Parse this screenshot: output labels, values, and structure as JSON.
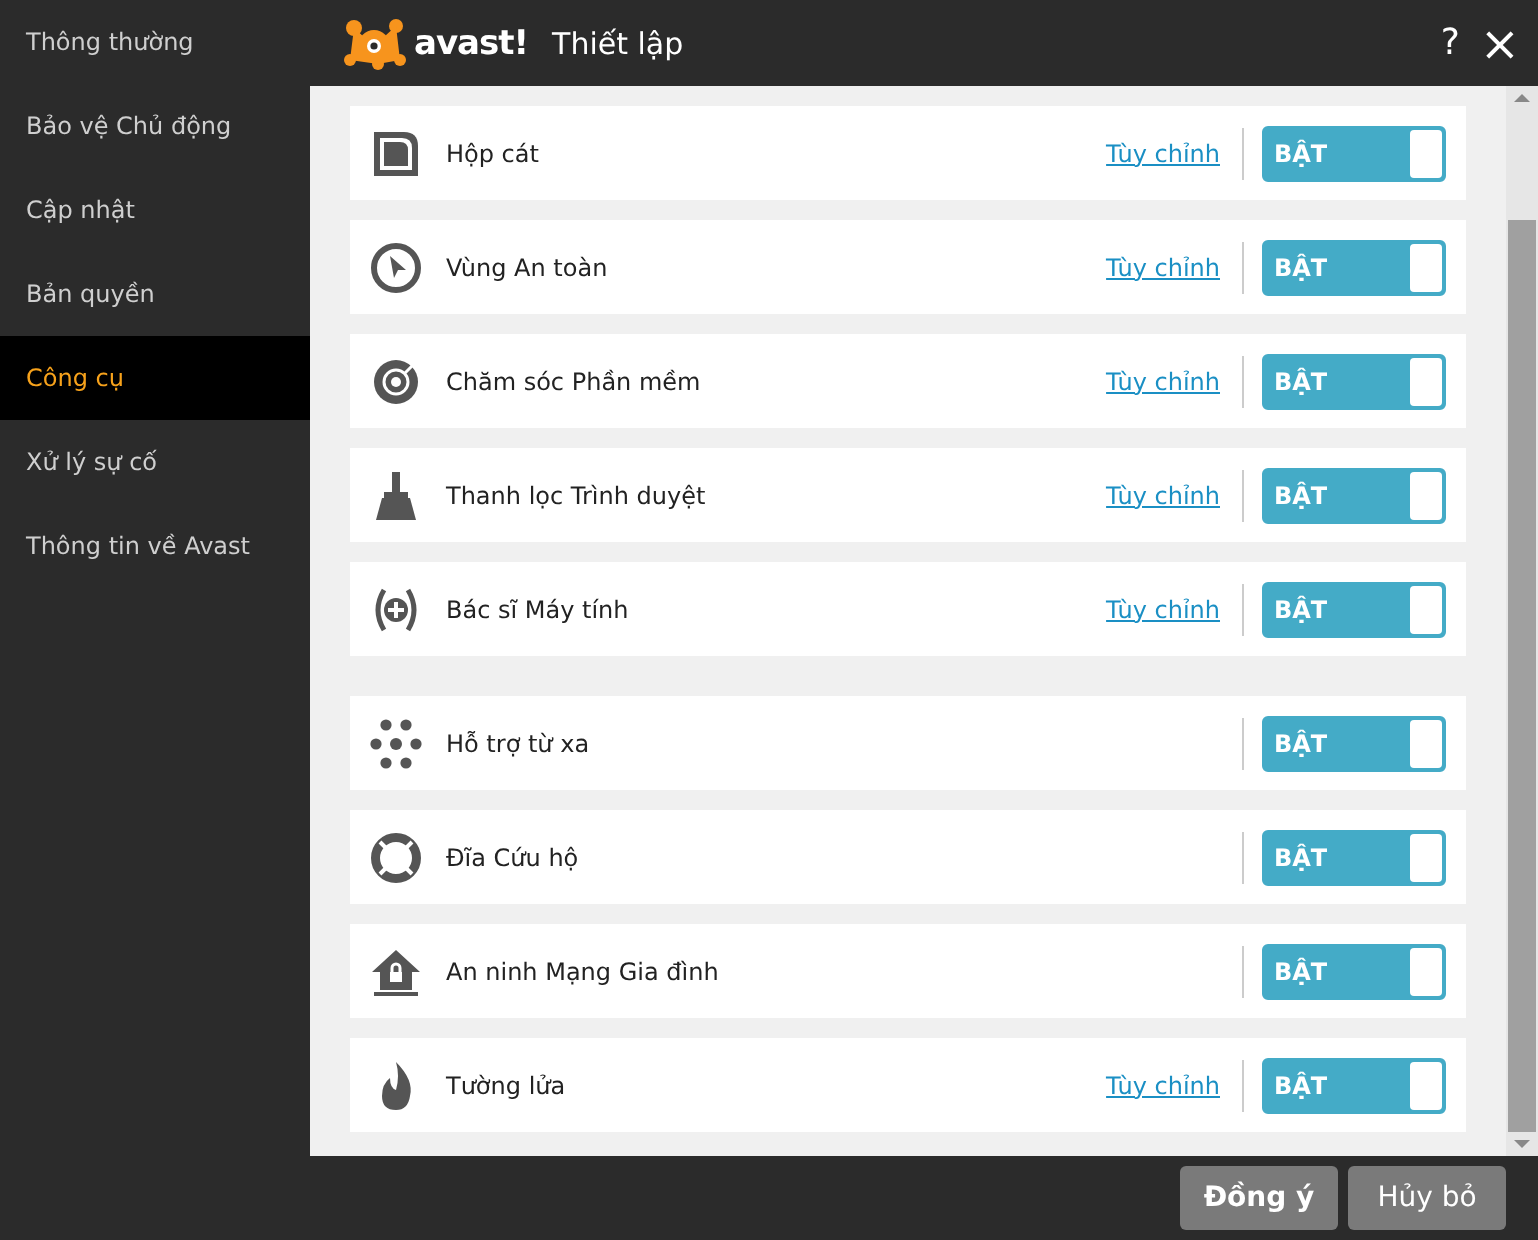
{
  "sidebar": {
    "items": [
      {
        "label": "Thông thường",
        "selected": false
      },
      {
        "label": "Bảo vệ Chủ động",
        "selected": false
      },
      {
        "label": "Cập nhật",
        "selected": false
      },
      {
        "label": "Bản quyền",
        "selected": false
      },
      {
        "label": "Công cụ",
        "selected": true
      },
      {
        "label": "Xử lý sự cố",
        "selected": false
      },
      {
        "label": "Thông tin về Avast",
        "selected": false
      }
    ]
  },
  "window": {
    "logo_text": "avast!",
    "title": "Thiết lập",
    "help": "?",
    "close": "×"
  },
  "groups": [
    {
      "items": [
        {
          "name": "Hộp cát",
          "link": "Tùy chỉnh",
          "toggle": "BẬT",
          "on": true
        },
        {
          "name": "Vùng An toàn",
          "link": "Tùy chỉnh",
          "toggle": "BẬT",
          "on": true
        },
        {
          "name": "Chăm sóc Phần mềm",
          "link": "Tùy chỉnh",
          "toggle": "BẬT",
          "on": true
        },
        {
          "name": "Thanh lọc Trình duyệt",
          "link": "Tùy chỉnh",
          "toggle": "BẬT",
          "on": true
        },
        {
          "name": "Bác sĩ Máy tính",
          "link": "Tùy chỉnh",
          "toggle": "BẬT",
          "on": true
        }
      ]
    },
    {
      "items": [
        {
          "name": "Hỗ trợ từ xa",
          "toggle": "BẬT",
          "on": true
        },
        {
          "name": "Đĩa Cứu hộ",
          "toggle": "BẬT",
          "on": true
        },
        {
          "name": "An ninh Mạng Gia đình",
          "toggle": "BẬT",
          "on": true
        },
        {
          "name": "Tường lửa",
          "link": "Tùy chỉnh",
          "toggle": "BẬT",
          "on": true
        }
      ]
    }
  ],
  "buttons": [
    "Đồng ý",
    "Hủy bỏ"
  ]
}
